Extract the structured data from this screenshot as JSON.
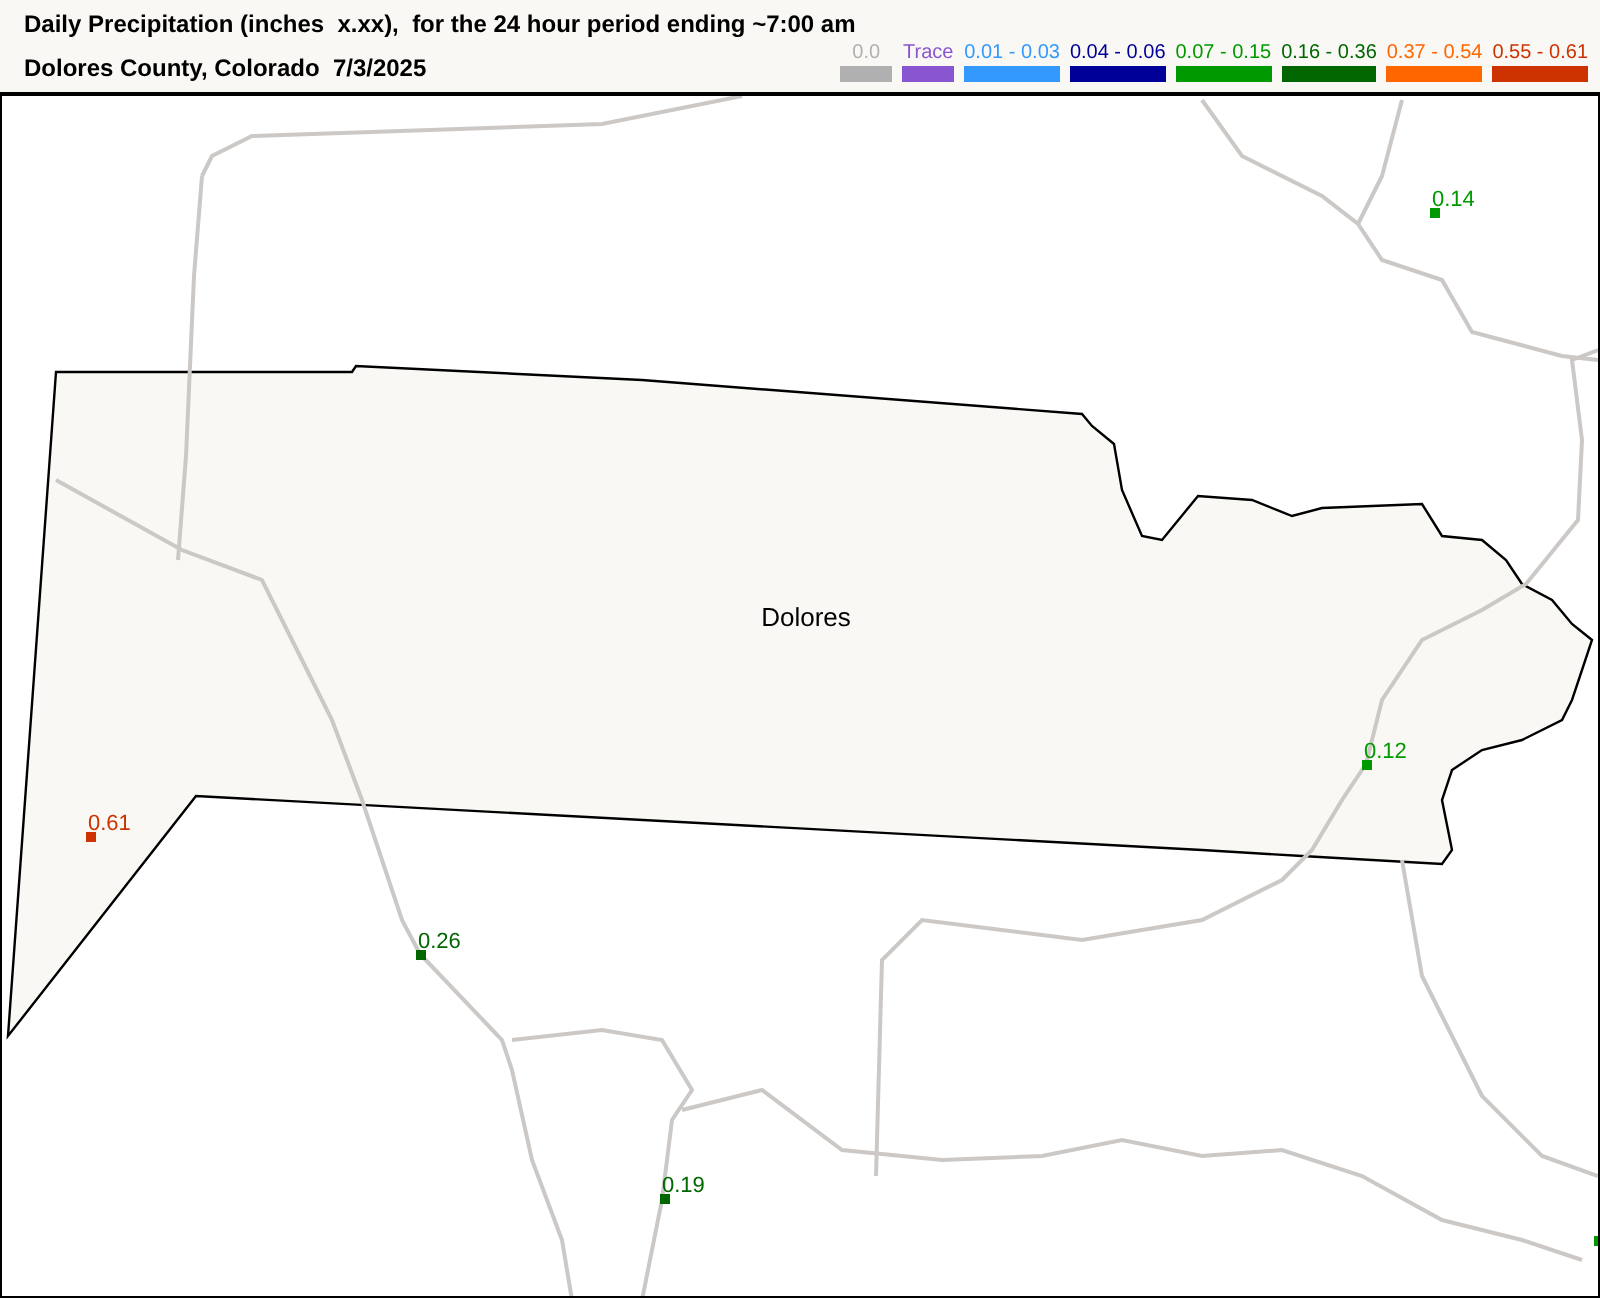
{
  "title": "Daily Precipitation (inches  x.xx),  for the 24 hour period ending ~7:00 am",
  "subtitle": "Dolores County, Colorado  7/3/2025",
  "legend": [
    {
      "label": "0.0",
      "color": "#b0b0b0"
    },
    {
      "label": "Trace",
      "color": "#8a55d0"
    },
    {
      "label": "0.01 - 0.03",
      "color": "#3399ff"
    },
    {
      "label": "0.04 - 0.06",
      "color": "#000099"
    },
    {
      "label": "0.07 - 0.15",
      "color": "#009900"
    },
    {
      "label": "0.16 - 0.36",
      "color": "#006600"
    },
    {
      "label": "0.37 - 0.54",
      "color": "#ff6600"
    },
    {
      "label": "0.55 - 0.61",
      "color": "#cc3300"
    }
  ],
  "map": {
    "county_label": "Dolores",
    "stations": [
      {
        "value": "0.14",
        "color": "#009900"
      },
      {
        "value": "0.12",
        "color": "#009900"
      },
      {
        "value": "0.61",
        "color": "#cc3300"
      },
      {
        "value": "0.26",
        "color": "#006600"
      },
      {
        "value": "0.19",
        "color": "#006600"
      },
      {
        "color": "#009900"
      }
    ]
  }
}
